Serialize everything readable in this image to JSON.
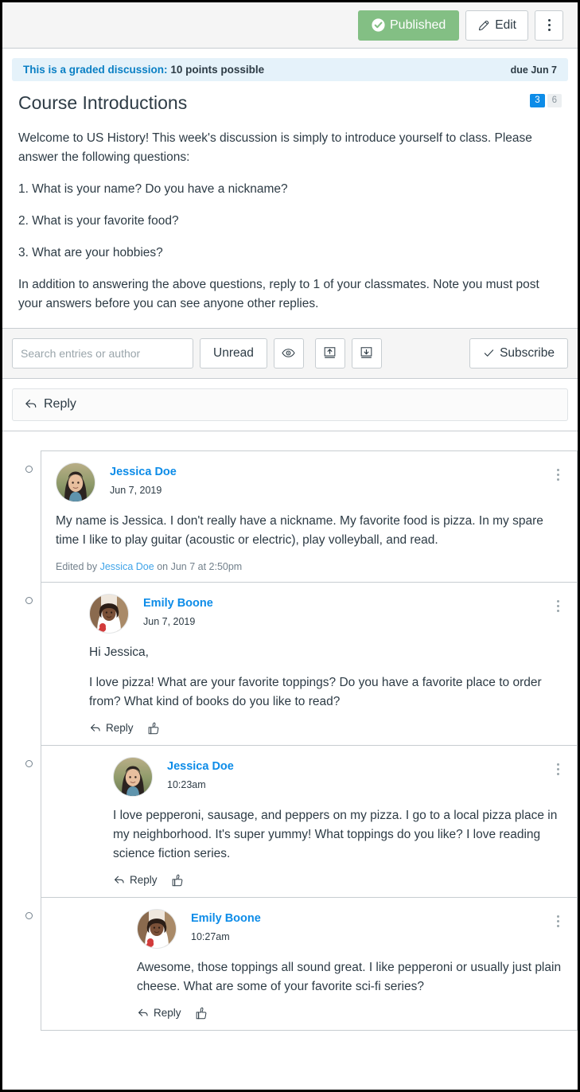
{
  "header": {
    "published_label": "Published",
    "edit_label": "Edit",
    "published_color": "#83bf84",
    "options_label": "Options"
  },
  "graded_banner": {
    "prefix": "This is a graded discussion:",
    "points": "10 points possible",
    "due": "due Jun 7",
    "background": "#e5f2fa",
    "link_color": "#0a7fc4"
  },
  "discussion": {
    "title": "Course Introductions",
    "unread_count": "3",
    "total_count": "6",
    "paragraphs": [
      "Welcome to US History! This week's discussion is simply to introduce yourself to class. Please answer the following questions:",
      "1. What is your name? Do you have a nickname?",
      "2. What is your favorite food?",
      "3. What are your hobbies?",
      "In addition to answering the above questions, reply to 1 of your classmates. Note you must post your answers before you can see anyone other replies."
    ]
  },
  "toolbar": {
    "search_placeholder": "Search entries or author",
    "search_value": "",
    "unread_label": "Unread",
    "eye_icon": "eye-icon",
    "collapse_icon": "collapse-replies-icon",
    "expand_icon": "expand-replies-icon",
    "subscribe_label": "Subscribe"
  },
  "composer": {
    "reply_label": "Reply"
  },
  "entries": [
    {
      "level": 0,
      "author": "Jessica Doe",
      "timestamp": "Jun 7, 2019",
      "avatar": "woman-dark-hair-outdoors",
      "paragraphs": [
        "My name is Jessica. I don't really have a nickname. My favorite food is pizza. In my spare time I like to play guitar (acoustic or electric), play volleyball, and read."
      ],
      "edited": {
        "prefix": "Edited by",
        "author": "Jessica Doe",
        "suffix": "on Jun 7 at 2:50pm"
      },
      "actions": []
    },
    {
      "level": 1,
      "author": "Emily Boone",
      "timestamp": "Jun 7, 2019",
      "avatar": "woman-curly-hair-red",
      "paragraphs": [
        "Hi Jessica,",
        "I love pizza! What are your favorite toppings? Do you have a favorite place to order from? What kind of books do you like to read?"
      ],
      "edited": null,
      "actions": [
        "Reply",
        "Like"
      ]
    },
    {
      "level": 2,
      "author": "Jessica Doe",
      "timestamp": "10:23am",
      "avatar": "woman-dark-hair-outdoors",
      "paragraphs": [
        "I love pepperoni, sausage, and peppers on my pizza. I go to a local pizza place in my neighborhood. It's super yummy! What toppings do you like? I love reading science fiction series."
      ],
      "edited": null,
      "actions": [
        "Reply",
        "Like"
      ]
    },
    {
      "level": 3,
      "author": "Emily Boone",
      "timestamp": "10:27am",
      "avatar": "woman-curly-hair-red",
      "paragraphs": [
        "Awesome, those toppings all sound great. I like pepperoni or usually just plain cheese. What are some of your favorite sci-fi series?"
      ],
      "edited": null,
      "actions": [
        "Reply",
        "Like"
      ]
    }
  ]
}
